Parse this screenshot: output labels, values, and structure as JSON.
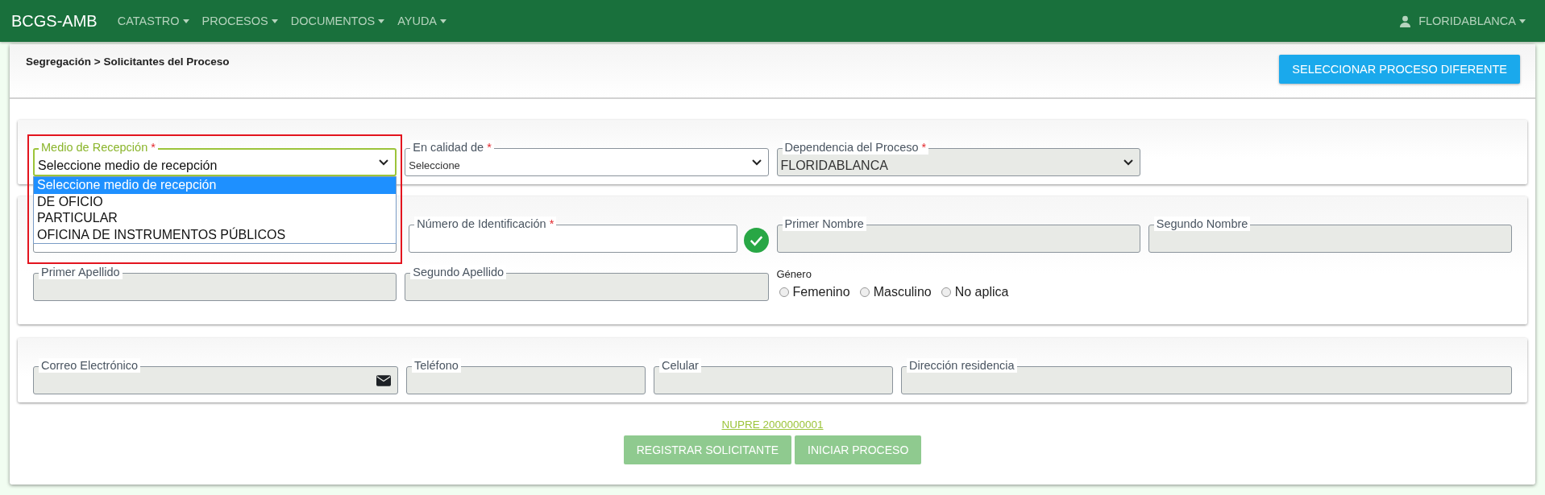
{
  "navbar": {
    "brand": "BCGS-AMB",
    "menus": [
      {
        "label": "CATASTRO"
      },
      {
        "label": "PROCESOS"
      },
      {
        "label": "DOCUMENTOS"
      },
      {
        "label": "AYUDA"
      }
    ],
    "user": "FLORIDABLANCA"
  },
  "header": {
    "breadcrumb": "Segregación > Solicitantes del Proceso",
    "button": "SELECCIONAR PROCESO DIFERENTE"
  },
  "reception": {
    "fields": [
      {
        "kind": "select",
        "label": "Medio de Recepción",
        "required_mark": "*",
        "value": "Seleccione medio de recepción",
        "focused": true,
        "disabled": false,
        "highlighted": true
      },
      {
        "kind": "select",
        "label": "En calidad de",
        "required_mark": "*",
        "value": "Seleccione",
        "focused": false,
        "disabled": false,
        "highlighted": false
      },
      {
        "kind": "select",
        "label": "Dependencia del Proceso",
        "required_mark": "*",
        "value": "FLORIDABLANCA",
        "focused": false,
        "disabled": true,
        "highlighted": false
      }
    ]
  },
  "dropdown": {
    "options": [
      {
        "label": "Seleccione medio de recepción",
        "selected": true
      },
      {
        "label": "DE OFICIO",
        "selected": false
      },
      {
        "label": "PARTICULAR",
        "selected": false
      },
      {
        "label": "OFICINA DE INSTRUMENTOS PÚBLICOS",
        "selected": false
      }
    ]
  },
  "identity": {
    "document_type": {
      "disabled": false
    },
    "id_number": {
      "label": "Número de Identificación",
      "required_mark": "*",
      "disabled": false,
      "verified": true
    },
    "names": [
      {
        "label": "Primer Nombre",
        "disabled": true
      },
      {
        "label": "Segundo Nombre",
        "disabled": true
      }
    ],
    "surnames": [
      {
        "label": "Primer Apellido",
        "disabled": true
      },
      {
        "label": "Segundo Apellido",
        "disabled": true
      }
    ],
    "gender": {
      "label": "Género",
      "options": [
        {
          "label": "Femenino",
          "checked": false
        },
        {
          "label": "Masculino",
          "checked": false
        },
        {
          "label": "No aplica",
          "checked": false
        }
      ]
    }
  },
  "contact": {
    "fields": [
      {
        "kind": "email",
        "label": "Correo Electrónico",
        "disabled": true
      },
      {
        "kind": "text",
        "label": "Teléfono",
        "disabled": true
      },
      {
        "kind": "text",
        "label": "Celular",
        "disabled": true
      },
      {
        "kind": "text",
        "label": "Dirección residencia",
        "disabled": true
      }
    ]
  },
  "nupre_link": "NUPRE 2000000001",
  "actions": [
    {
      "label": "REGISTRAR SOLICITANTE",
      "disabled": true
    },
    {
      "label": "INICIAR PROCESO",
      "disabled": true
    }
  ]
}
